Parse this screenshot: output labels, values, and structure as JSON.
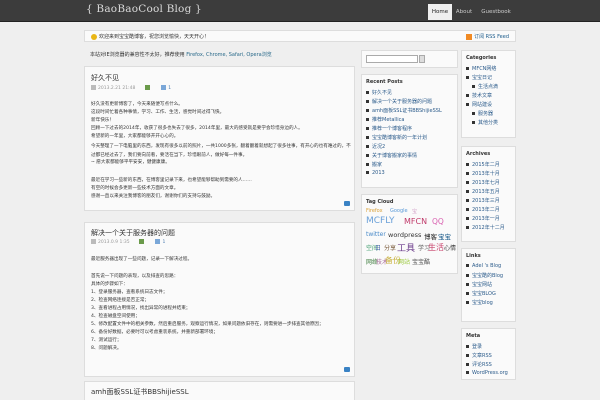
{
  "site_title": "{ BaoBaoCool Blog }",
  "nav": {
    "home": "Home",
    "about": "About",
    "guestbook": "Guestbook"
  },
  "notice": {
    "text": "欢迎来到宝宝酷博客，祝您浏览愉快，天天开心！",
    "rss": "订阅 RSS Feed"
  },
  "browser_tip": {
    "prefix": "本站对IE浏览器的兼容性不太好，推荐使用 ",
    "browsers": "Firefox, Chrome, Safari, Opera浏览"
  },
  "posts": [
    {
      "title": "好久不见",
      "date": "2013.2.21  21:48",
      "comments": "1",
      "lines": [
        "好久没有更新博客了，今天来随便写点什么。",
        "这段时间忙着各种事情，学习、工作、生活，感觉时间过得飞快。",
        "新年快乐！",
        "回顾一下过去的2014年，收获了很多也失去了很多，2014年里，最大的感受就是要学会珍惜身边的人。",
        "希望新的一年里，大家都能够开开心心的。",
        "今天整理了一下电脑里的东西，发现有很多以前的照片，一共1000多张，翻着翻着就想起了很多往事，有开心的也有难过的，不过都已经过去了，我们要向前看，要活在当下，珍惜眼前人，做好每一件事。",
        "~ 愿大家都能够平平安安，健健康康。",
        "",
        "最近在学习一些新的东西，在博客里记录下来，也希望能够帮助到需要的人……",
        "有空的时候会多更新一些技术方面的文章。",
        "感谢一直以来关注我博客的朋友们，谢谢你们的支持与鼓励。"
      ]
    },
    {
      "title": "解决一个关于服务器的问题",
      "date": "2013.0.9  1:35",
      "comments": "1",
      "lines": [
        "最近服务器出现了一些问题，记录一下解决过程。",
        "",
        "首先说一下问题的表现，以及排查的思路：",
        "具体的步骤如下：",
        "1、登录服务器，查看系统日志文件；",
        "2、检查网络连接是否正常；",
        "3、查看进程占用情况，找出异常的进程并结束；",
        "4、检查磁盘空间使用；",
        "5、修改配置文件中的相关参数，然后重启服务，观察运行情况，如果问题依旧存在，则需要进一步排查其他原因；",
        "6、备份好数据，必要时可以考虑重装系统，并重新部署环境；",
        "7、测试运行；",
        "8、问题解决。"
      ]
    },
    {
      "title": "amh面板SSL证书BBShijieSSL"
    }
  ],
  "recent_posts": {
    "title": "Recent Posts",
    "items": [
      "好久不见",
      "解决一个关于服务器的问题",
      "amh面板SSL证书BBShijieSSL",
      "推荐Metallica",
      "推荐一个博客程序",
      "宝宝酷博客新的一年计划",
      "近况2",
      "关于博客搬家的事情",
      "搬家",
      "2013"
    ]
  },
  "tag_cloud": {
    "title": "Tag Cloud",
    "tags": [
      "Firefox",
      "Google",
      "宝",
      "MCFLY",
      "MFCN",
      "QQ",
      "twitter",
      "wordpress",
      "博客",
      "宝宝",
      "空间",
      "日",
      "分享",
      "工具",
      "学习",
      "生活",
      "心情",
      "网络",
      "技术",
      "备份",
      "网站",
      "宝宝酷",
      "音乐",
      "电影",
      "服务器",
      "系统"
    ]
  },
  "categories": {
    "title": "Categories",
    "items": [
      "MFCN网络",
      "宝宝日记",
      "生活点滴",
      "技术文章",
      "网站建设",
      "服务器",
      "其他分类"
    ]
  },
  "archives": {
    "title": "Archives",
    "items": [
      "2015年二月",
      "2013年十月",
      "2013年七月",
      "2013年五月",
      "2013年三月",
      "2013年二月",
      "2013年一月",
      "2012年十二月"
    ]
  },
  "links": {
    "title": "Links",
    "items": [
      "Adel 's Blog",
      "宝宝酷的Blog",
      "宝宝网站",
      "宝宝BLOG",
      "宝宝blog"
    ]
  },
  "meta": {
    "title": "Meta",
    "items": [
      "登录",
      "文章RSS",
      "评论RSS",
      "WordPress.org"
    ]
  }
}
